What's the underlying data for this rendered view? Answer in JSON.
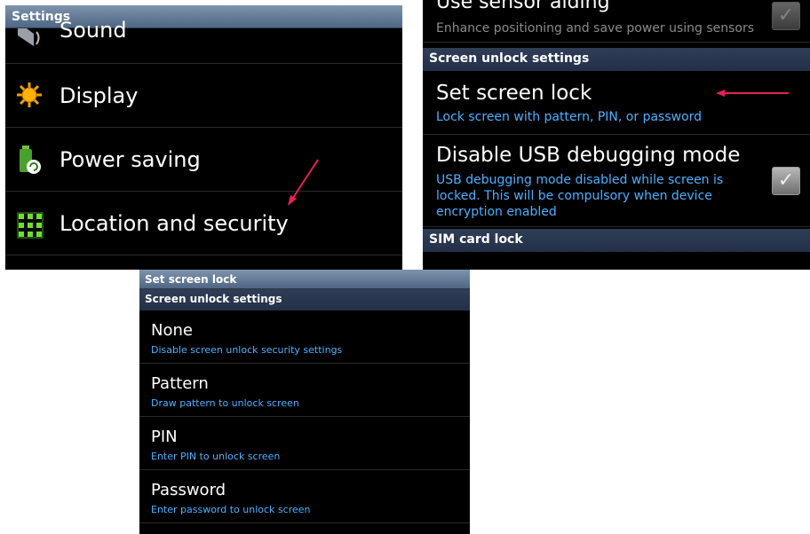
{
  "panel1": {
    "title": "Settings",
    "items": [
      {
        "label": "Sound",
        "icon": "speaker-icon"
      },
      {
        "label": "Display",
        "icon": "sun-icon"
      },
      {
        "label": "Power saving",
        "icon": "battery-recycle-icon"
      },
      {
        "label": "Location and security",
        "icon": "grid-dots-icon"
      }
    ]
  },
  "panel2": {
    "sensor": {
      "title": "Use sensor aiding",
      "subtitle": "Enhance positioning and save power using sensors",
      "checked": true
    },
    "section1": "Screen unlock settings",
    "set_lock": {
      "title": "Set screen lock",
      "subtitle": "Lock screen with pattern, PIN, or password"
    },
    "usb": {
      "title": "Disable USB debugging mode",
      "subtitle_lines": [
        "USB debugging mode disabled while screen is",
        "locked. This will be compulsory when device",
        "encryption enabled"
      ],
      "checked": true
    },
    "section2": "SIM card lock"
  },
  "panel3": {
    "title": "Set screen lock",
    "section": "Screen unlock settings",
    "options": [
      {
        "title": "None",
        "subtitle": "Disable screen unlock security settings"
      },
      {
        "title": "Pattern",
        "subtitle": "Draw pattern to unlock screen"
      },
      {
        "title": "PIN",
        "subtitle": "Enter PIN to unlock screen"
      },
      {
        "title": "Password",
        "subtitle": "Enter password to unlock screen"
      }
    ]
  },
  "colors": {
    "accent_blue": "#4fb0ff",
    "annotation_arrow": "#e8205a",
    "header": "#4f6784"
  }
}
